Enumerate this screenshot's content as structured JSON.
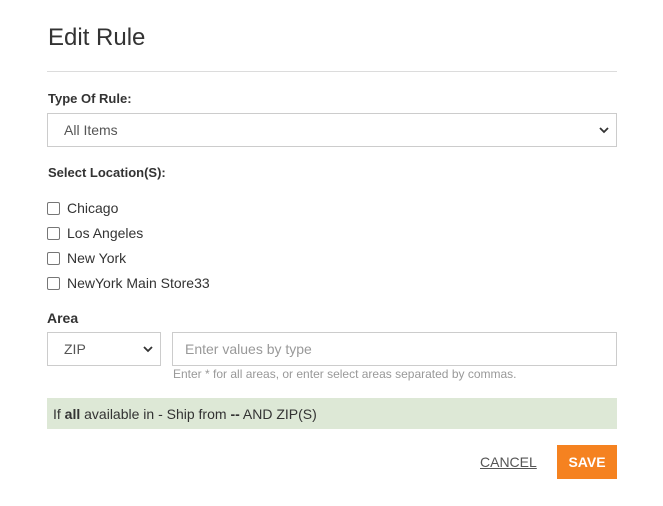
{
  "dialog": {
    "title": "Edit Rule"
  },
  "rule_type": {
    "label": "Type Of Rule:",
    "selected": "All Items"
  },
  "locations": {
    "label": "Select Location(S):",
    "items": [
      {
        "label": "Chicago",
        "checked": false
      },
      {
        "label": "Los Angeles",
        "checked": false
      },
      {
        "label": "New York",
        "checked": false
      },
      {
        "label": "NewYork Main Store33",
        "checked": false
      }
    ]
  },
  "area": {
    "label": "Area",
    "type_selected": "ZIP",
    "values_placeholder": "Enter values by type",
    "hint": "Enter * for all areas, or enter select areas separated by commas."
  },
  "summary": {
    "prefix": "If ",
    "scope": "all",
    "middle": " available in - Ship from ",
    "source": "--",
    "suffix": " AND ZIP(S)"
  },
  "actions": {
    "cancel_label": "CANCEL",
    "save_label": "SAVE"
  },
  "colors": {
    "accent": "#f58220",
    "summary_bg": "#dde8d6"
  }
}
